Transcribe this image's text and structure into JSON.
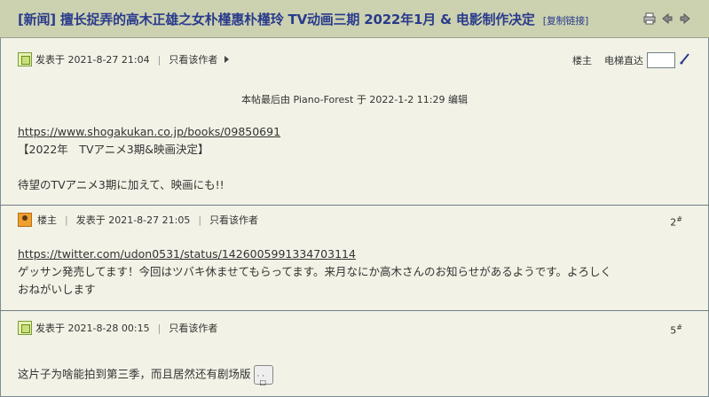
{
  "header": {
    "title": "[新闻] 擅长捉弄的高木正雄之女朴槿惠朴槿玲 TV动画三期 2022年1月 & 电影制作决定",
    "copy_link": "[复制链接]",
    "icons": [
      "print-icon",
      "prev-icon",
      "next-icon"
    ]
  },
  "tools": {
    "owner_label": "楼主",
    "jump_label": "电梯直达",
    "jump_value": ""
  },
  "posts": [
    {
      "meta_posted": "发表于 2021-8-27 21:04",
      "only_author": "只看该作者",
      "edited_note": "本帖最后由 Piano-Forest 于 2022-1-2 11:29 编辑",
      "link": "https://www.shogakukan.co.jp/books/09850691",
      "line1": "【2022年　TVアニメ3期&映画決定】",
      "line2": "待望のTVアニメ3期に加えて、映画にも!!"
    },
    {
      "owner_badge": "楼主",
      "meta_posted": "发表于 2021-8-27 21:05",
      "only_author": "只看该作者",
      "floor": "2",
      "floor_mark": "#",
      "link": "https://twitter.com/udon0531/status/1426005991334703114",
      "line1": "ゲッサン発売してます！今回はツバキ休ませてもらってます。来月なにか高木さんのお知らせがあるようです。よろしく",
      "line2": "おねがいします"
    },
    {
      "meta_posted": "发表于 2021-8-28 00:15",
      "only_author": "只看该作者",
      "floor": "5",
      "floor_mark": "#",
      "line1": "这片子为啥能拍到第三季，而且居然还有剧场版"
    }
  ]
}
